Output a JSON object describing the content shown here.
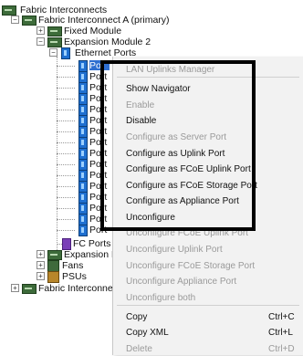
{
  "tree": {
    "root": "Fabric Interconnects",
    "fi_a": "Fabric Interconnect A (primary)",
    "fixed_module": "Fixed Module",
    "expansion_module_2": "Expansion Module 2",
    "ethernet_ports": "Ethernet Ports",
    "port_label": "Port",
    "port_labels_visible": [
      "Por",
      "Port",
      "Port",
      "Port",
      "Port",
      "Port",
      "Port",
      "Port",
      "Port",
      "Port",
      "Port",
      "Port",
      "Port",
      "Port",
      "Port",
      "Port"
    ],
    "fc_ports": "FC Ports",
    "expansion_module_other": "Expansion M",
    "fans": "Fans",
    "psus": "PSUs",
    "fi_b": "Fabric Interconnect"
  },
  "context_menu": {
    "items": [
      {
        "label": "LAN Uplinks Manager",
        "enabled": false
      },
      {
        "label": "Show Navigator",
        "enabled": true
      },
      {
        "label": "Enable",
        "enabled": false
      },
      {
        "label": "Disable",
        "enabled": true
      },
      {
        "label": "Configure as Server Port",
        "enabled": false
      },
      {
        "label": "Configure as Uplink Port",
        "enabled": true
      },
      {
        "label": "Configure as FCoE Uplink Port",
        "enabled": true
      },
      {
        "label": "Configure as FCoE Storage Port",
        "enabled": true
      },
      {
        "label": "Configure as Appliance Port",
        "enabled": true
      },
      {
        "label": "Unconfigure",
        "enabled": true
      },
      {
        "label": "Unconfigure FCoE Uplink Port",
        "enabled": false
      },
      {
        "label": "Unconfigure Uplink Port",
        "enabled": false
      },
      {
        "label": "Unconfigure FCoE Storage Port",
        "enabled": false
      },
      {
        "label": "Unconfigure Appliance Port",
        "enabled": false
      },
      {
        "label": "Unconfigure both",
        "enabled": false
      },
      {
        "label": "Copy",
        "enabled": true,
        "shortcut": "Ctrl+C"
      },
      {
        "label": "Copy XML",
        "enabled": true,
        "shortcut": "Ctrl+L"
      },
      {
        "label": "Delete",
        "enabled": false,
        "shortcut": "Ctrl+D"
      }
    ]
  },
  "colors": {
    "highlight_border": "#000000",
    "selection": "#2f6fd0",
    "disabled_text": "#9a9a9a"
  }
}
